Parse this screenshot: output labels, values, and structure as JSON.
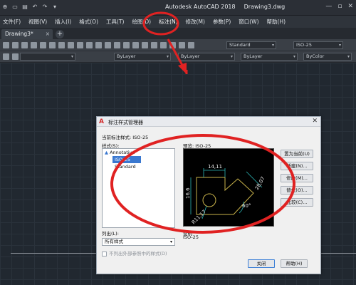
{
  "app": {
    "title": "Autodesk AutoCAD 2018",
    "document": "Drawing3.dwg"
  },
  "menu": [
    {
      "label": "文件(F)",
      "highlight": false
    },
    {
      "label": "视图(V)",
      "highlight": false
    },
    {
      "label": "插入(I)",
      "highlight": false
    },
    {
      "label": "格式(O)",
      "highlight": false
    },
    {
      "label": "工具(T)",
      "highlight": false
    },
    {
      "label": "绘图(D)",
      "highlight": false
    },
    {
      "label": "标注(N)",
      "highlight": true
    },
    {
      "label": "修改(M)",
      "highlight": false
    },
    {
      "label": "参数(P)",
      "highlight": false
    },
    {
      "label": "窗口(W)",
      "highlight": false
    },
    {
      "label": "帮助(H)",
      "highlight": false
    }
  ],
  "tabs": [
    {
      "label": "Drawing3*",
      "active": true
    }
  ],
  "toolbar": {
    "layer_value": "ByLayer",
    "text_style": "Standard",
    "dim_style": "ISO-25",
    "linetype": "ByLayer",
    "lineweight": "ByLayer",
    "color": "ByColor"
  },
  "dialog": {
    "title": "标注样式管理器",
    "current_style_label": "当前标注样式: ISO-25",
    "styles_label": "样式(S):",
    "styles": [
      "Annotative",
      "ISO-25",
      "Standard"
    ],
    "selected_style": "ISO-25",
    "preview_label": "预览: ISO-25",
    "list_label": "列出(L):",
    "list_value": "所有样式",
    "exclude_xref_label": "不列出外部参照中的样式(D)",
    "description_label": "说明",
    "description_value": "ISO-25",
    "buttons": {
      "set_current": "置为当前(U)",
      "new": "新建(N)...",
      "modify": "修改(M)...",
      "override": "替代(O)...",
      "compare": "比较(C)...",
      "close": "关闭",
      "help": "帮助(H)"
    },
    "preview_dims": {
      "top": "14,11",
      "left": "16,6",
      "right": "28,07",
      "angle": "60°",
      "radius": "R11,17"
    }
  },
  "annotation_color": "#e02222"
}
